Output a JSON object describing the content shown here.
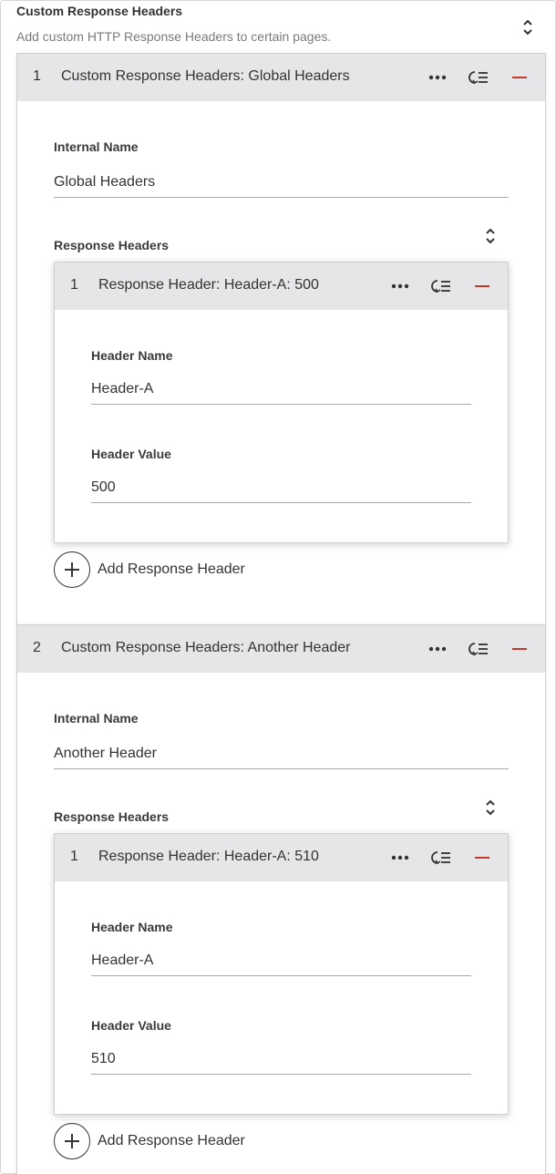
{
  "field": {
    "title": "Custom Response Headers",
    "help": "Add custom HTTP Response Headers to certain pages.",
    "collapse_icon": "collapse-icon"
  },
  "groups": [
    {
      "index": "1",
      "label": "Custom Response Headers: Global Headers",
      "internal_name_label": "Internal Name",
      "internal_name_value": "Global Headers",
      "response_headers_label": "Response Headers",
      "headers": [
        {
          "index": "1",
          "label": "Response Header: Header-A: 500",
          "name_label": "Header Name",
          "name_value": "Header-A",
          "value_label": "Header Value",
          "value_value": "500"
        }
      ],
      "add_label": "Add Response Header"
    },
    {
      "index": "2",
      "label": "Custom Response Headers: Another Header",
      "internal_name_label": "Internal Name",
      "internal_name_value": "Another Header",
      "response_headers_label": "Response Headers",
      "headers": [
        {
          "index": "1",
          "label": "Response Header: Header-A: 510",
          "name_label": "Header Name",
          "name_value": "Header-A",
          "value_label": "Header Value",
          "value_value": "510"
        }
      ],
      "add_label": "Add Response Header"
    }
  ],
  "icons": {
    "more": "more-horizontal-icon",
    "toggle": "collapse-item-icon",
    "remove": "remove-icon",
    "add": "plus-circle-icon"
  },
  "colors": {
    "remove": "#c0392b",
    "header_bg": "#e6e6e8",
    "text": "#333333",
    "muted": "#7a7a7a"
  }
}
